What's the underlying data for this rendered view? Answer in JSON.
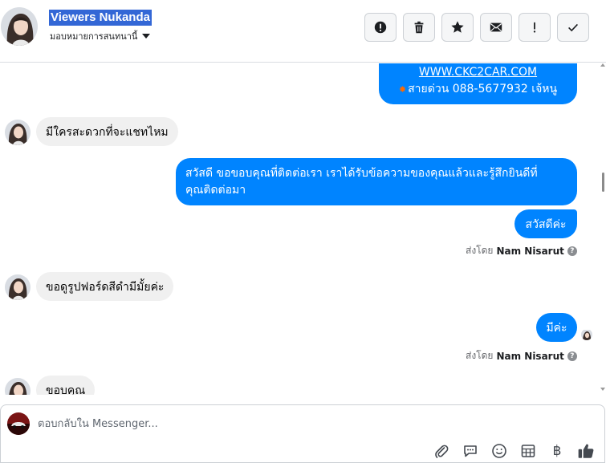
{
  "header": {
    "contact_name": "Viewers Nukanda",
    "assign_label": "มอบหมายการสนทนานี้",
    "actions": [
      {
        "name": "spam-button",
        "icon": "exclamation-circle-icon"
      },
      {
        "name": "delete-button",
        "icon": "trash-icon"
      },
      {
        "name": "star-button",
        "icon": "star-icon"
      },
      {
        "name": "mark-unread-button",
        "icon": "envelope-icon"
      },
      {
        "name": "follow-up-button",
        "icon": "exclamation-icon"
      },
      {
        "name": "mark-done-button",
        "icon": "check-icon"
      }
    ]
  },
  "messages": {
    "m1_link": "WWW.CKC2CAR.COM",
    "m1_hotline": "สายด่วน 088-5677932 เจ้หนู",
    "m2": "มีใครสะดวกที่จะแชทไหม",
    "m3_line1": "สวัสดี ขอขอบคุณที่ติดต่อเรา เราได้รับข้อความของคุณแล้วและรู้สึกยินดีที่",
    "m3_line2": "คุณติดต่อมา",
    "m4": "สวัสดีค่ะ",
    "sent_by_1_prefix": "ส่งโดย",
    "sent_by_1_name": "Nam Nisarut",
    "m5": "ขอดูรูปฟอร์ดสีดำมีมั้ยค่ะ",
    "m6": "มีค่ะ",
    "sent_by_2_prefix": "ส่งโดย",
    "sent_by_2_name": "Nam Nisarut",
    "m7": "ขอบคุณ"
  },
  "composer": {
    "placeholder": "ตอบกลับใน Messenger...",
    "tools": [
      "paperclip-icon",
      "chat-bubble-icon",
      "emoji-icon",
      "table-icon",
      "baht-icon",
      "thumbs-up-icon"
    ],
    "baht_symbol": "฿"
  },
  "colors": {
    "outgoing_bubble": "#0084ff",
    "incoming_bubble": "#f0f0f0",
    "name_highlight": "#3367d6"
  }
}
